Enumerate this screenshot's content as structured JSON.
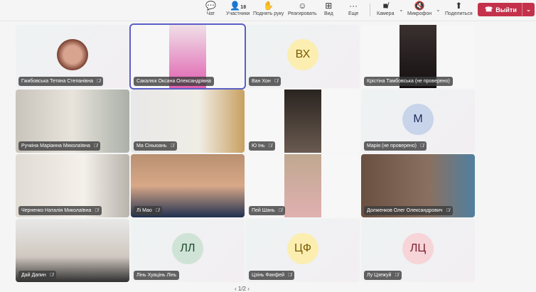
{
  "toolbar": {
    "chat": "Чат",
    "participants": "Участники",
    "participants_count": "18",
    "raise_hand": "Поднять руку",
    "react": "Реагировать",
    "view": "Вид",
    "more": "Еще",
    "camera": "Камера",
    "mic": "Микрофон",
    "share": "Поделиться",
    "leave": "Выйти"
  },
  "tiles": [
    {
      "name": "Гжибовська Тетяна Степанівна"
    },
    {
      "name": "Сакалюк Оксана Олександрівна"
    },
    {
      "name": "Ван Хон",
      "initials": "ВХ"
    },
    {
      "name": "Крістіна Тамбовська (не проверено)"
    },
    {
      "name": "Ручкіна Маріанна Миколаївна"
    },
    {
      "name": "Ма Сіньюань"
    },
    {
      "name": "Ю Інь"
    },
    {
      "name": "Марія (не проверено)",
      "initials": "M"
    },
    {
      "name": "Черненко Наталія Миколаївна"
    },
    {
      "name": "Лі Мао"
    },
    {
      "name": "Пей Шань"
    },
    {
      "name": "Долженков Олег Олександрович"
    },
    {
      "name": "Дай Дапин"
    },
    {
      "name": "Лінь Хуацінь Лінь",
      "initials": "ЛЛ"
    },
    {
      "name": "Цзінь Фанфей",
      "initials": "ЦФ"
    },
    {
      "name": "Лу Цзежуй",
      "initials": "ЛЦ"
    }
  ],
  "pager": "‹ 1/2 ›"
}
